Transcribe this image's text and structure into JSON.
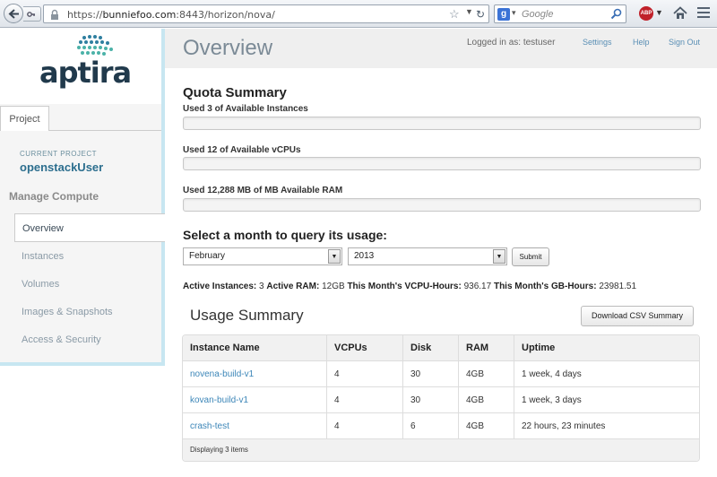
{
  "browser": {
    "url_scheme": "https://",
    "url_host": "bunniefoo.com",
    "url_path": ":8443/horizon/nova/",
    "search_placeholder": "Google",
    "search_engine_icon": "g-icon",
    "abp_label": "ABP"
  },
  "sidebar": {
    "logo_text": "aptira",
    "tab_label": "Project",
    "current_project_label": "CURRENT PROJECT",
    "current_project": "openstackUser",
    "section_heading": "Manage Compute",
    "items": [
      {
        "label": "Overview",
        "active": true
      },
      {
        "label": "Instances",
        "active": false
      },
      {
        "label": "Volumes",
        "active": false
      },
      {
        "label": "Images & Snapshots",
        "active": false
      },
      {
        "label": "Access & Security",
        "active": false
      }
    ]
  },
  "header": {
    "title": "Overview",
    "logged_in": "Logged in as: testuser",
    "links": [
      "Settings",
      "Help",
      "Sign Out"
    ]
  },
  "quota": {
    "heading": "Quota Summary",
    "items": [
      {
        "label": "Used 3 of Available Instances",
        "fill_fraction": 0.0
      },
      {
        "label": "Used 12 of Available vCPUs",
        "fill_fraction": 0.0
      },
      {
        "label": "Used 12,288 MB of MB Available RAM",
        "fill_fraction": 0.0
      }
    ]
  },
  "usage_query": {
    "heading": "Select a month to query its usage:",
    "month": "February",
    "year": "2013",
    "submit_label": "Submit"
  },
  "stats": {
    "active_instances_label": "Active Instances:",
    "active_instances": "3",
    "active_ram_label": "Active RAM:",
    "active_ram": "12GB",
    "vcpu_hours_label": "This Month's VCPU-Hours:",
    "vcpu_hours": "936.17",
    "gb_hours_label": "This Month's GB-Hours:",
    "gb_hours": "23981.51"
  },
  "usage": {
    "heading": "Usage Summary",
    "download_label": "Download CSV Summary",
    "columns": [
      "Instance Name",
      "VCPUs",
      "Disk",
      "RAM",
      "Uptime"
    ],
    "rows": [
      [
        "novena-build-v1",
        "4",
        "30",
        "4GB",
        "1 week, 4 days"
      ],
      [
        "kovan-build-v1",
        "4",
        "30",
        "4GB",
        "1 week, 3 days"
      ],
      [
        "crash-test",
        "4",
        "6",
        "4GB",
        "22 hours, 23 minutes"
      ]
    ],
    "footer": "Displaying 3 items"
  }
}
